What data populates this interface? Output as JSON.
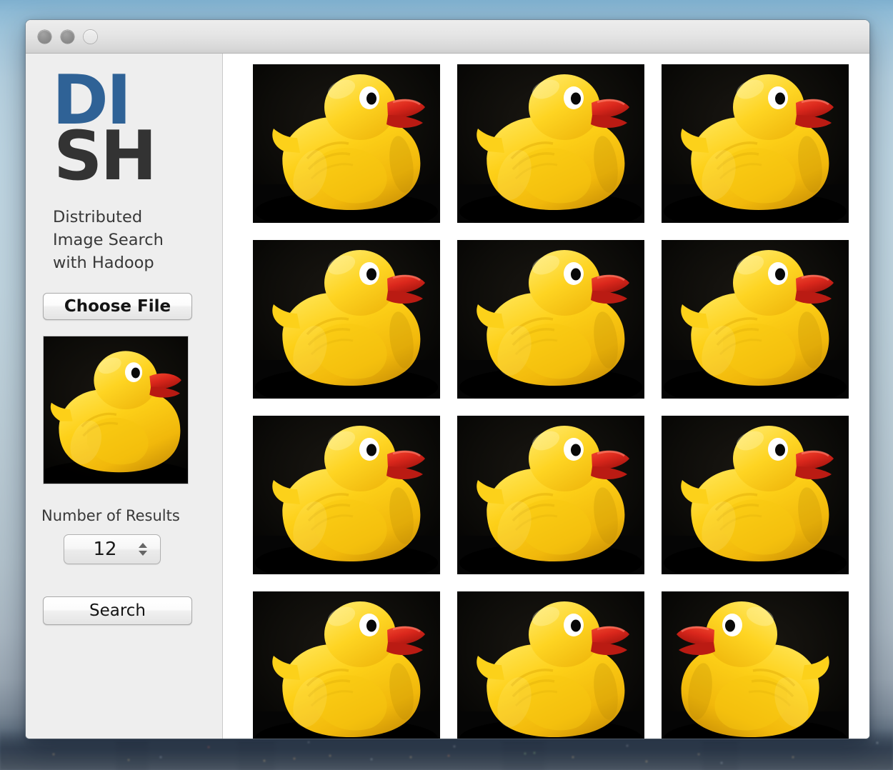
{
  "window": {
    "controls": [
      {
        "name": "close-button",
        "style": "filled"
      },
      {
        "name": "minimize-button",
        "style": "filled"
      },
      {
        "name": "zoom-button",
        "style": "hollow"
      }
    ]
  },
  "sidebar": {
    "logo": {
      "line1": "DI",
      "line2": "SH",
      "color_primary": "#2f6296",
      "color_secondary": "#333333"
    },
    "tagline": "Distributed Image Search with Hadoop",
    "choose_file_label": "Choose File",
    "preview": {
      "alt": "rubber-duck-query-image",
      "background": "#000000"
    },
    "results_count_label": "Number of Results",
    "results_count_value": "12",
    "search_label": "Search"
  },
  "results": {
    "thumbnails": [
      {
        "id": 1,
        "alt": "rubber-duck-result-1",
        "flipped": false
      },
      {
        "id": 2,
        "alt": "rubber-duck-result-2",
        "flipped": false
      },
      {
        "id": 3,
        "alt": "rubber-duck-result-3",
        "flipped": false
      },
      {
        "id": 4,
        "alt": "rubber-duck-result-4",
        "flipped": false
      },
      {
        "id": 5,
        "alt": "rubber-duck-result-5",
        "flipped": false
      },
      {
        "id": 6,
        "alt": "rubber-duck-result-6",
        "flipped": false
      },
      {
        "id": 7,
        "alt": "rubber-duck-result-7",
        "flipped": false
      },
      {
        "id": 8,
        "alt": "rubber-duck-result-8",
        "flipped": false
      },
      {
        "id": 9,
        "alt": "rubber-duck-result-9",
        "flipped": false
      },
      {
        "id": 10,
        "alt": "rubber-duck-result-10",
        "flipped": false
      },
      {
        "id": 11,
        "alt": "rubber-duck-result-11",
        "flipped": false
      },
      {
        "id": 12,
        "alt": "rubber-duck-result-12",
        "flipped": true
      }
    ]
  },
  "desktop": {
    "wallpaper_description": "blurred city skyline at dusk",
    "sky_color": "#b8d0de"
  }
}
